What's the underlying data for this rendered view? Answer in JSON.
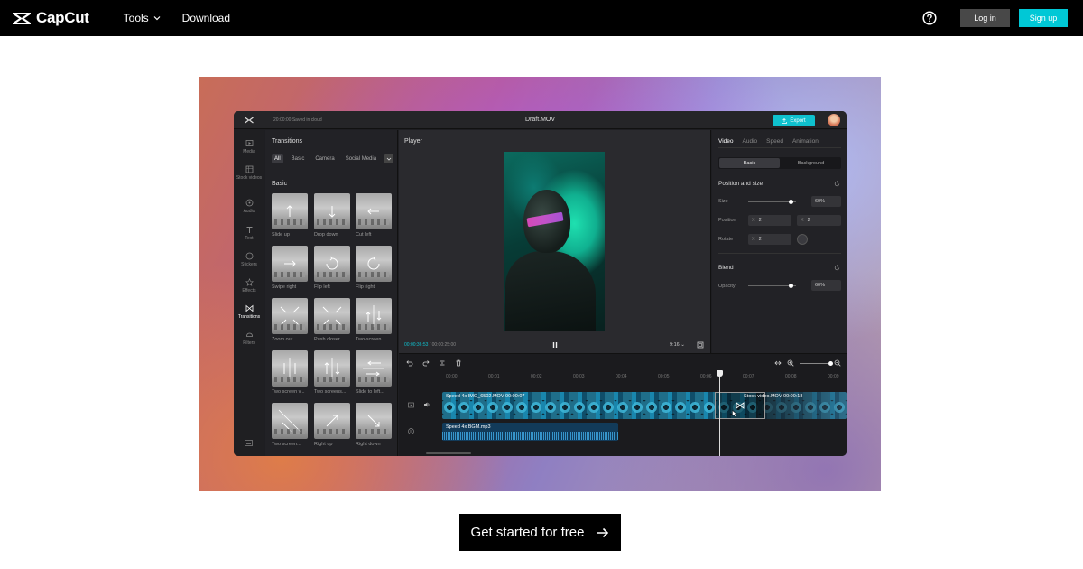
{
  "nav": {
    "logo_text": "CapCut",
    "tools_label": "Tools",
    "download_label": "Download",
    "login_label": "Log in",
    "signup_label": "Sign up"
  },
  "editor": {
    "saved_text": "20:00:00 Saved in cloud",
    "file_title": "Draft.MOV",
    "export_label": "Export",
    "sidebar": [
      {
        "label": "Media",
        "icon": "media-icon"
      },
      {
        "label": "Stock videos",
        "icon": "stock-videos-icon"
      },
      {
        "label": "Audio",
        "icon": "audio-icon"
      },
      {
        "label": "Text",
        "icon": "text-icon"
      },
      {
        "label": "Stickers",
        "icon": "stickers-icon"
      },
      {
        "label": "Effects",
        "icon": "effects-icon"
      },
      {
        "label": "Transitions",
        "icon": "transitions-icon"
      },
      {
        "label": "Filters",
        "icon": "filters-icon"
      }
    ],
    "panel": {
      "title": "Transitions",
      "tabs": [
        "All",
        "Basic",
        "Camera",
        "Social Media"
      ],
      "section": "Basic",
      "items": [
        "Slide up",
        "Drop down",
        "Cut left",
        "Swipe right",
        "Flip left",
        "Flip right",
        "Zoom out",
        "Push closer",
        "Two-screen...",
        "Two screen v...",
        "Two screens...",
        "Slide to left...",
        "Two screen...",
        "Right up",
        "Right down"
      ]
    },
    "player": {
      "title": "Player",
      "current_time": "00:00:36:53",
      "total_time": "00:00:25:00",
      "ratio": "9:16"
    },
    "props": {
      "tabs": [
        "Video",
        "Audio",
        "Speed",
        "Animation"
      ],
      "seg": [
        "Basic",
        "Background"
      ],
      "pos_size_title": "Position and size",
      "size_label": "Size",
      "size_value": "60%",
      "position_label": "Position",
      "pos_x": "2",
      "pos_y": "2",
      "rotate_label": "Rotate",
      "rotate_value": "2",
      "blend_title": "Blend",
      "opacity_label": "Opacity",
      "opacity_value": "60%",
      "axis_x": "X",
      "size_level": 0.9,
      "opacity_level": 0.9
    },
    "timeline": {
      "ticks": [
        "00:00",
        "00:01",
        "00:02",
        "00:03",
        "00:04",
        "00:05",
        "00:06",
        "00:07",
        "00:08",
        "00:09"
      ],
      "video_clip_label": "Speed 4x    IMG_6502.MOV    00:00:07",
      "video_clip2_label": "Stock video.MOV    00:00:18",
      "audio_clip_label": "Speed 4x    BGM.mp3"
    }
  },
  "cta": {
    "label": "Get started for free"
  }
}
